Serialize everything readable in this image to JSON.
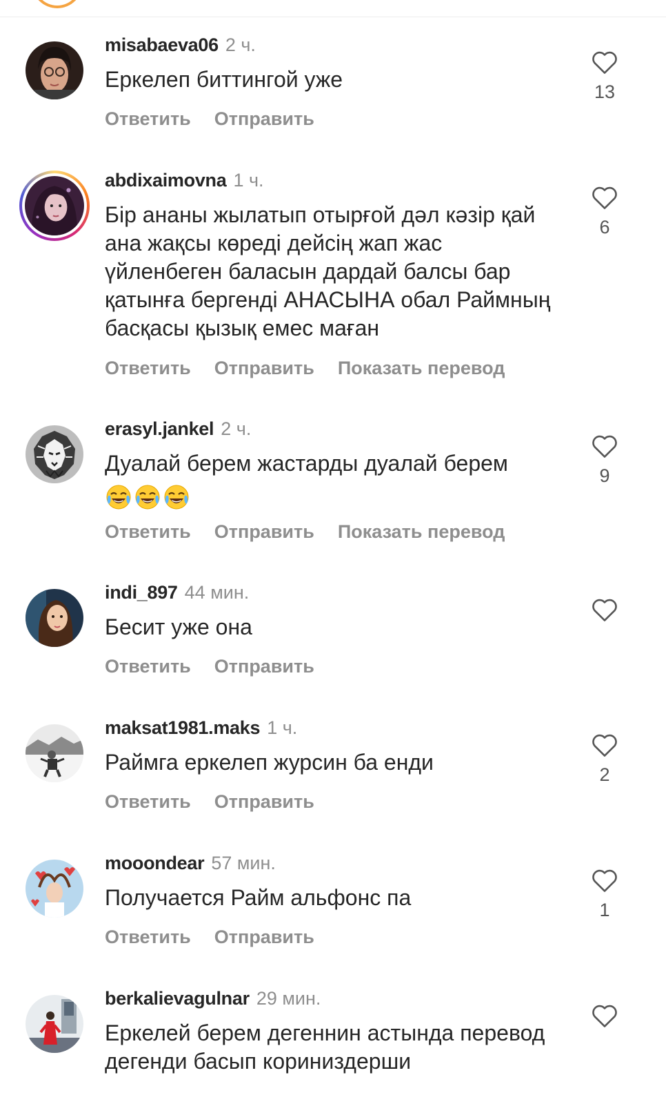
{
  "actions": {
    "reply": "Ответить",
    "send": "Отправить",
    "translate": "Показать перевод"
  },
  "comments": [
    {
      "username": "misabaeva06",
      "time": "2 ч.",
      "text": "Еркелеп биттингой уже",
      "likes": "13",
      "show_translate": false,
      "avatar": "avatar-woman-glasses"
    },
    {
      "username": "abdixaimovna",
      "time": "1 ч.",
      "text": "Бір ананы жылатып отырғой дәл кәзір қай ана жақсы көреді дейсің жап жас үйленбеген баласын дардай балсы бар қатынға бергенді АНАСЫНА обал Раймның басқасы қызық емес маған",
      "likes": "6",
      "show_translate": true,
      "avatar": "avatar-woman-story"
    },
    {
      "username": "erasyl.jankel",
      "time": "2 ч.",
      "text": "Дуалай берем жастарды дуалай берем",
      "emoji": [
        "tears-of-joy-emoji",
        "tears-of-joy-emoji",
        "tears-of-joy-emoji"
      ],
      "likes": "9",
      "show_translate": true,
      "avatar": "avatar-lion"
    },
    {
      "username": "indi_897",
      "time": "44 мин.",
      "text": "Бесит уже она",
      "likes": "",
      "show_translate": false,
      "avatar": "avatar-woman-long-hair"
    },
    {
      "username": "maksat1981.maks",
      "time": "1 ч.",
      "text": "Раймга еркелеп журсин ба енди",
      "likes": "2",
      "show_translate": false,
      "avatar": "avatar-man-snow"
    },
    {
      "username": "mooondear",
      "time": "57 мин.",
      "text": "Получается Райм альфонс па",
      "likes": "1",
      "show_translate": false,
      "avatar": "avatar-woman-hearts"
    },
    {
      "username": "berkalievagulnar",
      "time": "29 мин.",
      "text": "Еркелей берем дегеннин астында перевод дегенди басып кориниздерши",
      "likes": "",
      "show_translate": false,
      "avatar": "avatar-woman-red-coat"
    }
  ],
  "colors": {
    "text": "#262626",
    "muted": "#8e8e8e",
    "story_ring": "#d62976"
  }
}
